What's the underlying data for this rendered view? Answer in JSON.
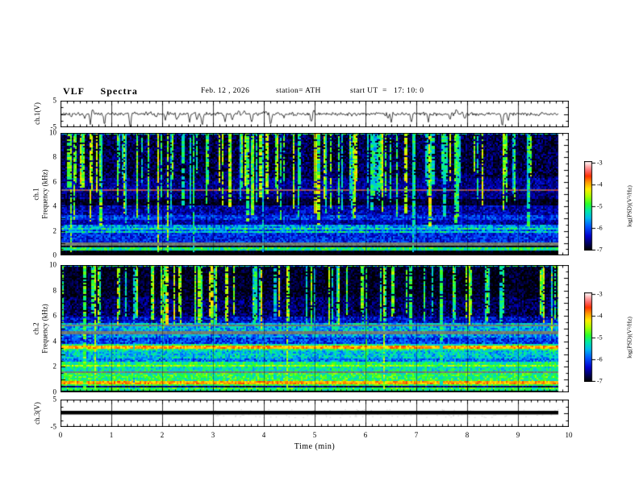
{
  "header": {
    "title": "VLF  Spectra",
    "date": "Feb. 12 , 2026",
    "station": "station= ATH",
    "start_ut": "start UT  =   17: 10: 0"
  },
  "xaxis": {
    "label": "Time  (min)",
    "ticks": [
      "0",
      "1",
      "2",
      "3",
      "4",
      "5",
      "6",
      "7",
      "8",
      "9",
      "10"
    ],
    "range": [
      0,
      10
    ],
    "minor_per_major": 8
  },
  "panels": {
    "ch1wave": {
      "ylabel": "ch.1(V)",
      "yticks": [
        "5",
        "-5"
      ],
      "ylim": [
        -5,
        5
      ]
    },
    "ch1spec": {
      "ylabel1": "ch.1",
      "ylabel2": "Frequency  (kHz)",
      "yticks": [
        "10",
        "8",
        "6",
        "4",
        "2",
        "0"
      ],
      "ylim": [
        0,
        10
      ]
    },
    "ch2spec": {
      "ylabel1": "ch.2",
      "ylabel2": "Frequency  (kHz)",
      "yticks": [
        "10",
        "8",
        "6",
        "4",
        "2",
        "0"
      ],
      "ylim": [
        0,
        10
      ]
    },
    "ch3wave": {
      "ylabel": "ch.3(V)",
      "yticks": [
        "5",
        "-5"
      ],
      "ylim": [
        -5,
        5
      ]
    }
  },
  "colorbar": {
    "label": "log(PSD)(V²/Hz)",
    "ticks": [
      "-3",
      "-4",
      "-5",
      "-6",
      "-7"
    ],
    "lim": [
      -7,
      -3
    ]
  },
  "colors": {
    "background": "#ffffff",
    "axis": "#000000",
    "trace": "#000000",
    "colormap_stops": [
      [
        0.0,
        "#000000"
      ],
      [
        0.07,
        "#000055"
      ],
      [
        0.16,
        "#0000cc"
      ],
      [
        0.27,
        "#0055ff"
      ],
      [
        0.37,
        "#00bbee"
      ],
      [
        0.45,
        "#00e8a8"
      ],
      [
        0.53,
        "#2aff2a"
      ],
      [
        0.62,
        "#aaff00"
      ],
      [
        0.7,
        "#ffee00"
      ],
      [
        0.78,
        "#ff9900"
      ],
      [
        0.85,
        "#ff3300"
      ],
      [
        0.91,
        "#ff6666"
      ],
      [
        0.96,
        "#ffaaaa"
      ],
      [
        1.0,
        "#ffe8e8"
      ]
    ]
  },
  "chart_data": [
    {
      "type": "line",
      "name": "ch.1(V) time series",
      "ylabel": "ch.1(V)",
      "ylim": [
        -5,
        5
      ],
      "x_range": [
        0,
        10
      ],
      "x_end": 9.8,
      "xlabel": "Time (min)",
      "noise_v": 0.9,
      "spike_count": 42,
      "spike_down_v": 3.5,
      "description": "noisy trace centered at 0 V with impulsive spikes, mostly downward to about -3.5 V"
    },
    {
      "type": "heatmap",
      "name": "ch.1 spectrogram",
      "ylabel": "ch.1 Frequency (kHz)",
      "ylim": [
        0,
        10
      ],
      "clim": [
        -7,
        -3
      ],
      "clabel": "log(PSD)(V²/Hz)",
      "x_range": [
        0,
        10
      ],
      "x_end": 9.8,
      "bands": [
        [
          10,
          9.85,
          -5.6,
          0.9,
          0
        ],
        [
          9.85,
          6.3,
          -6.78,
          0.38,
          0
        ],
        [
          6.3,
          5.45,
          -6.55,
          0.33,
          0
        ],
        [
          5.45,
          5.28,
          -4.6,
          0.3,
          2
        ],
        [
          5.28,
          4.6,
          -6.6,
          0.32,
          0
        ],
        [
          4.6,
          4.05,
          -6.88,
          0.22,
          0
        ],
        [
          4.05,
          3.35,
          -6.45,
          0.35,
          0
        ],
        [
          3.35,
          2.95,
          -6.1,
          0.42,
          0
        ],
        [
          2.95,
          2.55,
          -6.45,
          0.3,
          0
        ],
        [
          2.55,
          2.3,
          -5.7,
          0.5,
          0
        ],
        [
          2.3,
          2.15,
          -5.25,
          0.5,
          0
        ],
        [
          2.15,
          1.95,
          -5.9,
          0.45,
          0
        ],
        [
          1.95,
          1.82,
          -5.35,
          0.5,
          0
        ],
        [
          1.82,
          1.05,
          -6.15,
          0.4,
          0
        ],
        [
          1.05,
          0.85,
          0,
          0,
          1
        ],
        [
          0.85,
          0.76,
          -5.05,
          0.4,
          0
        ],
        [
          0.76,
          0.66,
          -6.9,
          0.2,
          0
        ],
        [
          0.66,
          0.58,
          -5.0,
          0.4,
          0
        ],
        [
          0.58,
          0.5,
          -6.9,
          0.2,
          0
        ],
        [
          0.5,
          0.42,
          -5.15,
          0.4,
          0
        ],
        [
          0.42,
          0.3,
          -6.95,
          0.15,
          0
        ],
        [
          0.3,
          0.22,
          -4.9,
          0.35,
          0
        ],
        [
          0.22,
          0.06,
          -7.05,
          0.1,
          0
        ],
        [
          0.06,
          -0.1,
          -5.8,
          0.5,
          0
        ]
      ],
      "streaks": {
        "count": 120,
        "stop_lo": 2.0,
        "stop_hi": 6.8,
        "level": -4.9,
        "full_prob": 0.06
      },
      "description": "dark blue background 4-10 kHz crossed by dense vertical cyan/green sferic streaks; purple-red line near 5.35 kHz; banded cyan/green structure below 2.5 kHz; gray band near 0.95 kHz; black band at 0-0.3 kHz"
    },
    {
      "type": "heatmap",
      "name": "ch.2 spectrogram",
      "ylabel": "ch.2 Frequency (kHz)",
      "ylim": [
        0,
        10
      ],
      "clim": [
        -7,
        -3
      ],
      "clabel": "log(PSD)(V²/Hz)",
      "x_range": [
        0,
        10
      ],
      "x_end": 9.8,
      "bands": [
        [
          10,
          9.85,
          -5.5,
          0.9,
          0
        ],
        [
          9.85,
          7.5,
          -6.9,
          0.28,
          0
        ],
        [
          7.5,
          6.0,
          -6.72,
          0.35,
          0
        ],
        [
          6.0,
          5.5,
          -6.35,
          0.4,
          0
        ],
        [
          5.5,
          5.32,
          -5.5,
          0.5,
          0
        ],
        [
          5.32,
          5.18,
          0,
          0,
          1
        ],
        [
          5.18,
          4.8,
          -5.55,
          0.5,
          0
        ],
        [
          4.8,
          4.62,
          0,
          0,
          1
        ],
        [
          4.62,
          4.25,
          -5.7,
          0.5,
          0
        ],
        [
          4.25,
          3.78,
          -6.05,
          0.45,
          0
        ],
        [
          3.78,
          3.66,
          -5.15,
          0.4,
          0
        ],
        [
          3.66,
          3.45,
          -3.95,
          0.3,
          0
        ],
        [
          3.45,
          3.28,
          -5.0,
          0.4,
          0
        ],
        [
          3.28,
          2.65,
          -5.45,
          0.45,
          0
        ],
        [
          2.65,
          2.35,
          -5.8,
          0.4,
          0
        ],
        [
          2.35,
          2.2,
          -5.1,
          0.4,
          0
        ],
        [
          2.2,
          2.03,
          -4.55,
          0.35,
          0
        ],
        [
          2.03,
          1.62,
          -5.25,
          0.4,
          0
        ],
        [
          1.62,
          1.5,
          0,
          0,
          1
        ],
        [
          1.5,
          0.92,
          -5.0,
          0.45,
          0
        ],
        [
          0.92,
          0.84,
          -4.75,
          0.3,
          0
        ],
        [
          0.84,
          0.62,
          -3.95,
          0.28,
          0
        ],
        [
          0.62,
          0.5,
          -4.9,
          0.3,
          0
        ],
        [
          0.5,
          0.42,
          -6.6,
          0.3,
          0
        ],
        [
          0.42,
          0.3,
          -4.9,
          0.35,
          0
        ],
        [
          0.3,
          0.2,
          -6.85,
          0.2,
          0
        ],
        [
          0.2,
          0.12,
          -5.05,
          0.3,
          0
        ],
        [
          0.12,
          -0.1,
          -6.95,
          0.15,
          0
        ]
      ],
      "streaks": {
        "count": 85,
        "stop_lo": 4.6,
        "stop_hi": 6.3,
        "level": -4.85,
        "full_prob": 0.05
      },
      "description": "dark blue 6-10 kHz with vertical green streaks; gray lines near 5.2 and 4.7 kHz; strong red band near 3.5 kHz; green/yellow region below 3 kHz; intense orange-red band near 0.7 kHz; dark band at 0-0.15 kHz"
    },
    {
      "type": "line",
      "name": "ch.3(V) time series",
      "ylabel": "ch.3(V)",
      "ylim": [
        -5,
        5
      ],
      "x_range": [
        0,
        10
      ],
      "x_end": 9.8,
      "xlabel": "Time (min)",
      "description": "flat saturated thick black line at 0 V for the whole record"
    }
  ]
}
